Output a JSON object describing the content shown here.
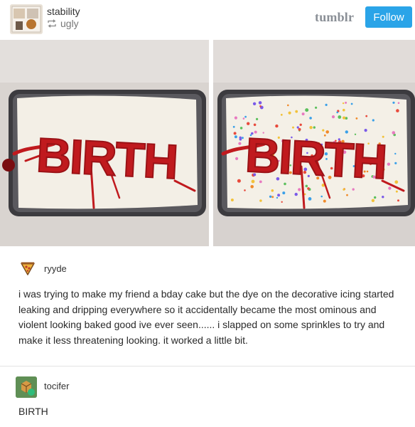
{
  "post": {
    "poster": "stability",
    "reblogged_from": "ugly",
    "brand": "tumblr",
    "follow_label": "Follow"
  },
  "photos": [
    {
      "alt": "cake-plain",
      "cake_text": "BIRTH"
    },
    {
      "alt": "cake-sprinkles",
      "cake_text": "BIRTH"
    }
  ],
  "replies": [
    {
      "user": "ryyde",
      "text": "i was trying to make my friend a bday cake but the dye on the decorative icing started leaking and dripping everywhere so it accidentally became the most ominous and violent looking baked good ive ever seen...... i slapped on some sprinkles to try and make it less threatening looking. it worked a little bit."
    },
    {
      "user": "tocifer",
      "text": "BIRTH"
    }
  ],
  "colors": {
    "accent_blue": "#2aa4e8",
    "icing_red": "#c01a1e"
  },
  "icons": {
    "reblog": "reblog-icon",
    "ryyde_avatar": "pizza-icon",
    "tocifer_avatar": "cube-icon"
  }
}
